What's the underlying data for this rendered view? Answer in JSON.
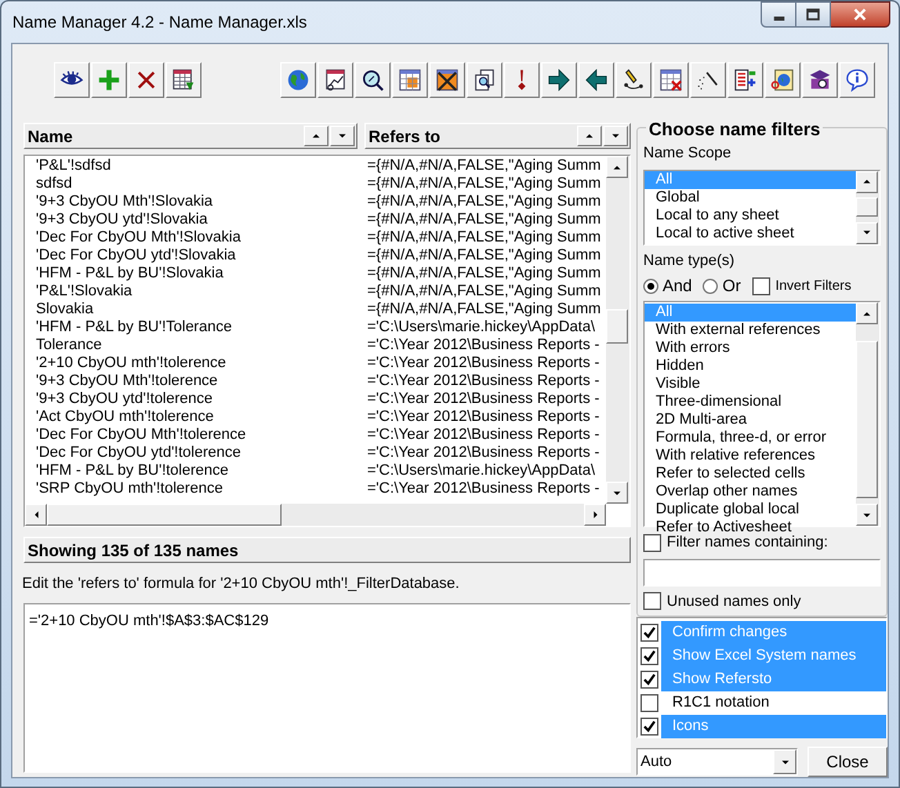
{
  "window": {
    "title": "Name Manager 4.2 - Name Manager.xls"
  },
  "columns": [
    {
      "label": "Name"
    },
    {
      "label": "Refers to"
    }
  ],
  "rows": [
    {
      "name": "'P&L'!sdfsd",
      "refers_to": "={#N/A,#N/A,FALSE,\"Aging Summ"
    },
    {
      "name": "sdfsd",
      "refers_to": "={#N/A,#N/A,FALSE,\"Aging Summ"
    },
    {
      "name": "'9+3 CbyOU Mth'!Slovakia",
      "refers_to": "={#N/A,#N/A,FALSE,\"Aging Summ"
    },
    {
      "name": "'9+3 CbyOU ytd'!Slovakia",
      "refers_to": "={#N/A,#N/A,FALSE,\"Aging Summ"
    },
    {
      "name": "'Dec For CbyOU Mth'!Slovakia",
      "refers_to": "={#N/A,#N/A,FALSE,\"Aging Summ"
    },
    {
      "name": "'Dec For CbyOU ytd'!Slovakia",
      "refers_to": "={#N/A,#N/A,FALSE,\"Aging Summ"
    },
    {
      "name": "'HFM - P&L by BU'!Slovakia",
      "refers_to": "={#N/A,#N/A,FALSE,\"Aging Summ"
    },
    {
      "name": "'P&L'!Slovakia",
      "refers_to": "={#N/A,#N/A,FALSE,\"Aging Summ"
    },
    {
      "name": "Slovakia",
      "refers_to": "={#N/A,#N/A,FALSE,\"Aging Summ"
    },
    {
      "name": "'HFM - P&L by BU'!Tolerance",
      "refers_to": "='C:\\Users\\marie.hickey\\AppData\\"
    },
    {
      "name": "Tolerance",
      "refers_to": "='C:\\Year 2012\\Business Reports -"
    },
    {
      "name": "'2+10 CbyOU mth'!tolerence",
      "refers_to": "='C:\\Year 2012\\Business Reports -"
    },
    {
      "name": "'9+3 CbyOU Mth'!tolerence",
      "refers_to": "='C:\\Year 2012\\Business Reports -"
    },
    {
      "name": "'9+3 CbyOU ytd'!tolerence",
      "refers_to": "='C:\\Year 2012\\Business Reports -"
    },
    {
      "name": "'Act CbyOU mth'!tolerence",
      "refers_to": "='C:\\Year 2012\\Business Reports -"
    },
    {
      "name": "'Dec For CbyOU Mth'!tolerence",
      "refers_to": "='C:\\Year 2012\\Business Reports -"
    },
    {
      "name": "'Dec For CbyOU ytd'!tolerence",
      "refers_to": "='C:\\Year 2012\\Business Reports -"
    },
    {
      "name": "'HFM - P&L by BU'!tolerence",
      "refers_to": "='C:\\Users\\marie.hickey\\AppData\\"
    },
    {
      "name": "'SRP CbyOU mth'!tolerence",
      "refers_to": "='C:\\Year 2012\\Business Reports -"
    }
  ],
  "status": "Showing 135 of 135 names",
  "edit_label": "Edit the 'refers to' formula for '2+10 CbyOU mth'!_FilterDatabase.",
  "formula": "='2+10 CbyOU mth'!$A$3:$AC$129",
  "filters": {
    "title": "Choose name filters",
    "scope_label": "Name Scope",
    "scope_items": [
      {
        "label": "All",
        "selected": true
      },
      {
        "label": "Global",
        "selected": false
      },
      {
        "label": "Local to any sheet",
        "selected": false
      },
      {
        "label": "Local to active sheet",
        "selected": false
      }
    ],
    "types_label": "Name type(s)",
    "modes": [
      {
        "label": "And",
        "selected": true
      },
      {
        "label": "Or",
        "selected": false
      }
    ],
    "invert": {
      "label": "Invert Filters",
      "checked": false
    },
    "type_items": [
      {
        "label": "All",
        "selected": true
      },
      {
        "label": "With external references",
        "selected": false
      },
      {
        "label": "With errors",
        "selected": false
      },
      {
        "label": "Hidden",
        "selected": false
      },
      {
        "label": "Visible",
        "selected": false
      },
      {
        "label": "Three-dimensional",
        "selected": false
      },
      {
        "label": "2D Multi-area",
        "selected": false
      },
      {
        "label": "Formula, three-d, or error",
        "selected": false
      },
      {
        "label": "With relative references",
        "selected": false
      },
      {
        "label": "Refer to selected cells",
        "selected": false
      },
      {
        "label": "Overlap other names",
        "selected": false
      },
      {
        "label": "Duplicate global local",
        "selected": false
      },
      {
        "label": "Refer to Activesheet",
        "selected": false
      }
    ],
    "containing": {
      "label": "Filter names containing:",
      "checked": false
    },
    "unused": {
      "label": "Unused names only",
      "checked": false
    }
  },
  "options": [
    {
      "label": "Confirm changes",
      "checked": true
    },
    {
      "label": "Show Excel System names",
      "checked": true
    },
    {
      "label": "Show Refersto",
      "checked": true
    },
    {
      "label": "R1C1 notation",
      "checked": false
    },
    {
      "label": "Icons",
      "checked": true
    }
  ],
  "mode_select": {
    "value": "Auto"
  },
  "close_button": "Close"
}
